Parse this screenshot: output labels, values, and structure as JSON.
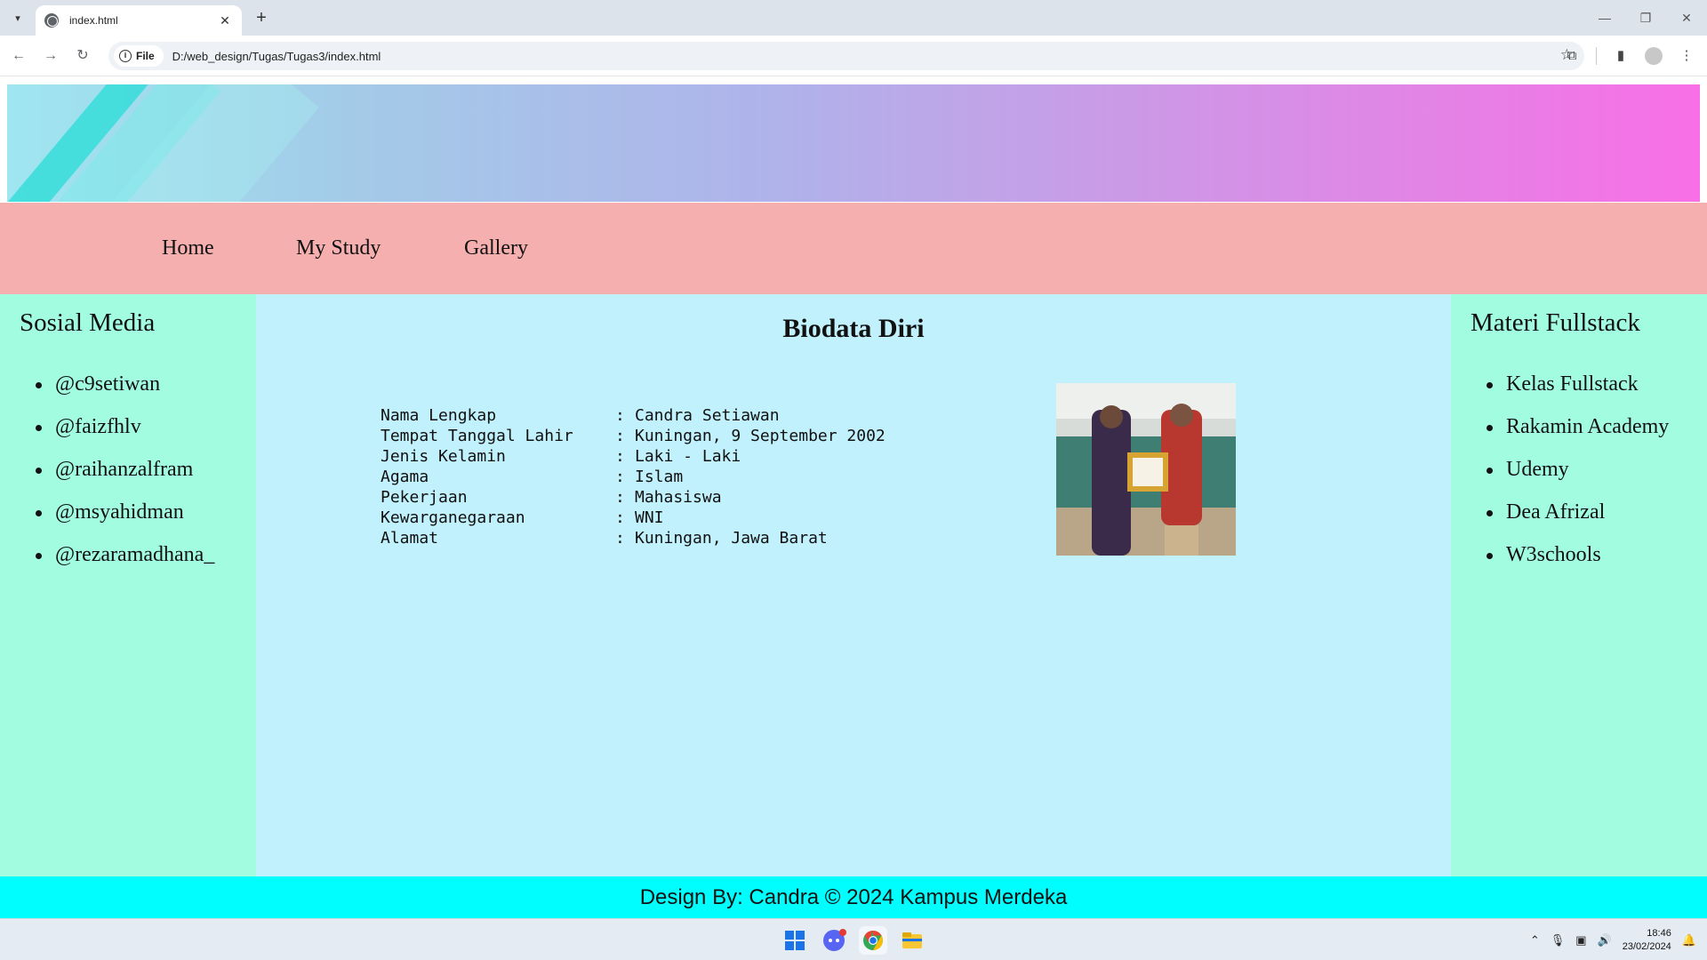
{
  "browser": {
    "tab_title": "index.html",
    "new_tab_label": "+",
    "site_chip": "File",
    "url": "D:/web_design/Tugas/Tugas3/index.html"
  },
  "nav": {
    "items": [
      {
        "label": "Home"
      },
      {
        "label": "My Study"
      },
      {
        "label": "Gallery"
      }
    ]
  },
  "left_sidebar": {
    "title": "Sosial Media",
    "items": [
      "@c9setiwan",
      "@faizfhlv",
      "@raihanzalfram",
      "@msyahidman",
      "@rezaramadhana_"
    ]
  },
  "main": {
    "title": "Biodata Diri",
    "biodata": [
      {
        "label": "Nama Lengkap",
        "sep": ":",
        "value": "Candra Setiawan"
      },
      {
        "label": "Tempat Tanggal Lahir",
        "sep": ":",
        "value": "Kuningan, 9 September 2002"
      },
      {
        "label": "Jenis Kelamin",
        "sep": ":",
        "value": "Laki - Laki"
      },
      {
        "label": "Agama",
        "sep": ":",
        "value": "Islam"
      },
      {
        "label": "Pekerjaan",
        "sep": ":",
        "value": "Mahasiswa"
      },
      {
        "label": "Kewarganegaraan",
        "sep": ":",
        "value": "WNI"
      },
      {
        "label": "Alamat",
        "sep": ":",
        "value": "Kuningan, Jawa Barat"
      }
    ]
  },
  "right_sidebar": {
    "title": "Materi Fullstack",
    "items": [
      "Kelas Fullstack",
      "Rakamin Academy",
      "Udemy",
      "Dea Afrizal",
      "W3schools"
    ]
  },
  "footer": {
    "text": "Design By: Candra © 2024 Kampus Merdeka"
  },
  "taskbar": {
    "time": "18:46",
    "date": "23/02/2024"
  },
  "colors": {
    "nav_bg": "#f5afaf",
    "sidebar_bg": "#a2fce0",
    "main_bg": "#c0f1fc",
    "footer_bg": "#00fefe"
  }
}
